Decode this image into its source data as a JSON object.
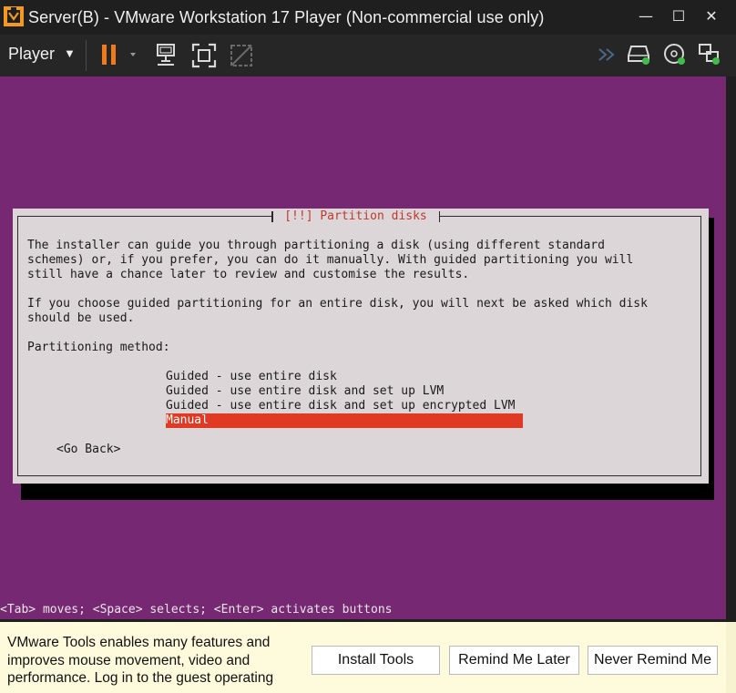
{
  "window": {
    "title": "Server(B) - VMware Workstation 17 Player (Non-commercial use only)",
    "minimize_glyph": "—",
    "maximize_glyph": "☐",
    "close_glyph": "✕"
  },
  "toolbar": {
    "player_label": "Player",
    "player_caret": "▼",
    "pause_color": "#f07a1a"
  },
  "installer": {
    "dialog_title": "[!!] Partition disks",
    "paragraph1": [
      "The installer can guide you through partitioning a disk (using different standard",
      "schemes) or, if you prefer, you can do it manually. With guided partitioning you will",
      "still have a chance later to review and customise the results."
    ],
    "paragraph2": [
      "If you choose guided partitioning for an entire disk, you will next be asked which disk",
      "should be used."
    ],
    "method_label": "Partitioning method:",
    "options": [
      "Guided - use entire disk",
      "Guided - use entire disk and set up LVM",
      "Guided - use entire disk and set up encrypted LVM",
      "Manual"
    ],
    "selected_option": "Manual",
    "go_back": "<Go Back>",
    "status_line": "<Tab> moves; <Space> selects; <Enter> activates buttons"
  },
  "notification": {
    "message": "VMware Tools enables many features and improves mouse movement, video and performance. Log in to the guest operating",
    "install_tools": "Install Tools",
    "remind_later": "Remind Me Later",
    "never_remind": "Never Remind Me"
  },
  "colors": {
    "vm_background": "#772873",
    "selection": "#e03a25",
    "dialog_title": "#c0392b",
    "notification_bg": "#fefbdc"
  }
}
